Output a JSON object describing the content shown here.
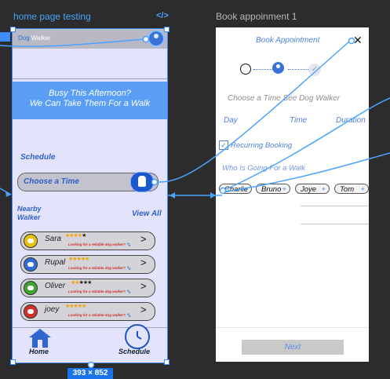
{
  "canvas": {
    "home_frame_label": "home page testing",
    "home_frame_code_icon": "</>",
    "book_frame_label": "Book appoinment 1",
    "size_badge": "393 × 852"
  },
  "home": {
    "brand": {
      "part1": "Dog",
      "part2": "Walker"
    },
    "hero": {
      "line1": "Busy This Afternoon?",
      "line2": "We Can Take Them For a Walk"
    },
    "schedule_label": "Schedule",
    "choose_time": "Choose a Time",
    "nearby_line1": "Nearby",
    "nearby_line2": "Walker",
    "view_all": "View All",
    "walkers": [
      {
        "name": "Sara",
        "stars": "★★★★",
        "stars_off": "★",
        "tagline": "Looking for a reliable dog walker? 🐾",
        "avatar_color": "#e6c20e"
      },
      {
        "name": "Rupal",
        "stars": "★★★★★",
        "stars_off": "",
        "tagline": "Looking for a reliable dog walker? 🐾",
        "avatar_color": "#2d6fd6"
      },
      {
        "name": "Oliver",
        "stars": "★★",
        "stars_off": "★★★",
        "tagline": "Looking for a reliable dog walker? 🐾",
        "avatar_color": "#3fa531"
      },
      {
        "name": "joey",
        "stars": "★★★★★",
        "stars_off": "",
        "tagline": "Looking for a reliable dog walker? 🐾",
        "avatar_color": "#d0302a"
      }
    ],
    "nav": {
      "home": "Home",
      "schedule": "Schedule"
    }
  },
  "book": {
    "title": "Book Appointment",
    "close": "✕",
    "step_done_mark": "✓",
    "choose_text": "Choose a Time See Dog Walker",
    "col_day": "Day",
    "col_time": "Time",
    "col_duration": "Duration",
    "checkbox_mark": "✓",
    "recurring": "Recurring Booking",
    "who": "Who Is Going For a Walk",
    "dogs": [
      {
        "name": "Charlie",
        "plus": "+"
      },
      {
        "name": "Bruno",
        "plus": "+"
      },
      {
        "name": "Joye",
        "plus": "+"
      },
      {
        "name": "Tom",
        "plus": "+"
      }
    ],
    "next": "Next"
  },
  "colors": {
    "accent": "#3f8cff",
    "hero_bg": "#5a9ff5",
    "frame_bg": "#e3e3fb",
    "canvas_bg": "#2c2c2c"
  }
}
